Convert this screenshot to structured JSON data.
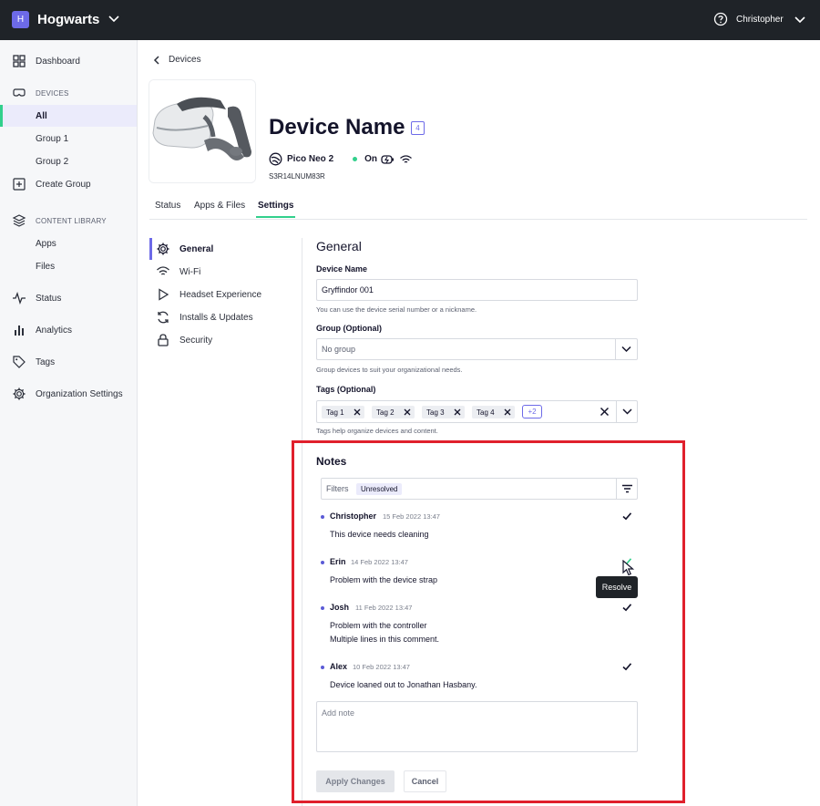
{
  "app": {
    "org_initial": "H",
    "org_name": "Hogwarts",
    "user_name": "Christopher",
    "accent": "#6d6ae8",
    "active_green": "#32d08c"
  },
  "sidebar": {
    "dashboard": "Dashboard",
    "devices_section": "DEVICES",
    "all": "All",
    "group1": "Group 1",
    "group2": "Group 2",
    "create_group": "Create Group",
    "content_section": "CONTENT LIBRARY",
    "apps": "Apps",
    "files": "Files",
    "status": "Status",
    "analytics": "Analytics",
    "tags": "Tags",
    "org_settings": "Organization Settings"
  },
  "device": {
    "breadcrumb": "Devices",
    "name": "Device Name",
    "count": "4",
    "model": "Pico Neo 2",
    "status": "On",
    "serial": "S3R14LNUM83R"
  },
  "tabs": {
    "status": "Status",
    "apps_files": "Apps & Files",
    "settings": "Settings"
  },
  "settings_nav": {
    "general": "General",
    "wifi": "Wi-Fi",
    "headset": "Headset Experience",
    "installs": "Installs & Updates",
    "security": "Security"
  },
  "form": {
    "title": "General",
    "name_label": "Device Name",
    "name_value": "Gryffindor 001",
    "name_help": "You can use the device serial number or a nickname.",
    "group_label": "Group (Optional)",
    "group_value": "No group",
    "group_help": "Group devices to suit your organizational needs.",
    "tags_label": "Tags (Optional)",
    "tags": [
      "Tag 1",
      "Tag 2",
      "Tag 3",
      "Tag 4"
    ],
    "tags_more": "+2",
    "tags_help": "Tags help organize devices and content."
  },
  "notes": {
    "title": "Notes",
    "filters_label": "Filters",
    "filter_chip": "Unresolved",
    "items": [
      {
        "author": "Christopher",
        "time": "15 Feb 2022 13:47",
        "line1": "This device needs cleaning",
        "line2": ""
      },
      {
        "author": "Erin",
        "time": "14 Feb 2022 13:47",
        "line1": "Problem with the device strap",
        "line2": ""
      },
      {
        "author": "Josh",
        "time": "11 Feb 2022 13:47",
        "line1": "Problem with the controller",
        "line2": "Multiple lines in this comment."
      },
      {
        "author": "Alex",
        "time": "10 Feb 2022 13:47",
        "line1": "Device loaned out to Jonathan Hasbany.",
        "line2": ""
      }
    ],
    "tooltip": "Resolve",
    "add_placeholder": "Add note",
    "apply": "Apply Changes",
    "cancel": "Cancel"
  }
}
